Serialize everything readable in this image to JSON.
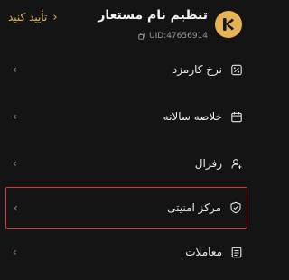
{
  "header": {
    "title": "تنظیم نام مستعار",
    "uid": "UID:47656914",
    "confirm_label": "تأیید کنید",
    "accent_color": "#e2b45a"
  },
  "menu": {
    "items": [
      {
        "label": "نرخ کارمزد",
        "icon": "percent-tag-icon"
      },
      {
        "label": "خلاصه سالانه",
        "icon": "calendar-icon"
      },
      {
        "label": "رفرال",
        "icon": "user-plus-icon"
      },
      {
        "label": "مرکز امنیتی",
        "icon": "shield-check-icon",
        "highlighted": true
      },
      {
        "label": "معاملات",
        "icon": "document-icon"
      }
    ],
    "highlight_color": "#d63b3b"
  }
}
